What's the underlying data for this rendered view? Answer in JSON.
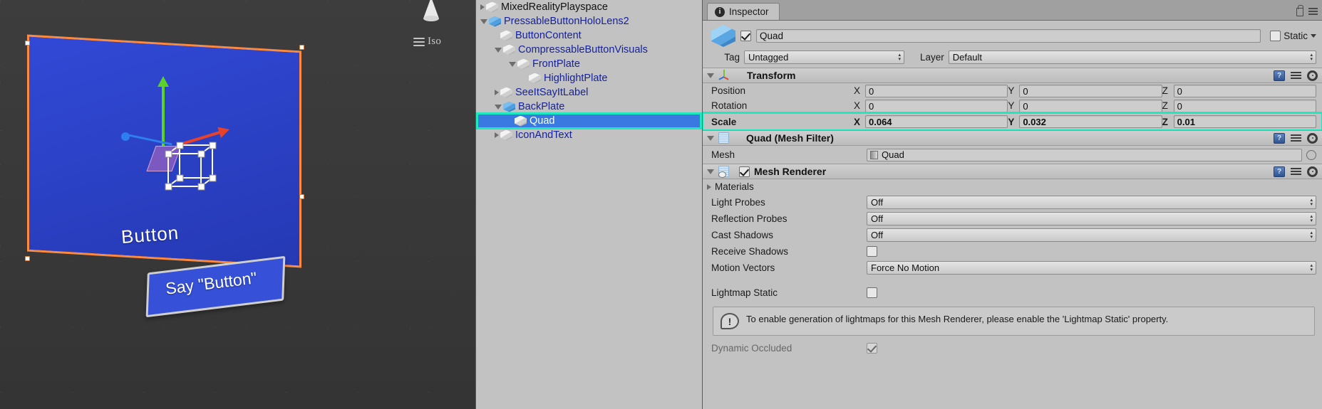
{
  "scene": {
    "view_label": "Iso",
    "button_text": "Button",
    "say_text": "Say \"Button\"",
    "gizmo_icon": "view-cube-gizmo",
    "colors": {
      "quad_fill": "#2b43c9",
      "quad_outline": "#ff8a3c",
      "x_axis": "#e8432a",
      "y_axis": "#5bd12a",
      "z_axis": "#2d7ff0"
    }
  },
  "hierarchy": {
    "items": [
      {
        "label": "MixedRealityPlayspace",
        "indent": 0,
        "toggle": "collapsed",
        "icon": "cube-icon",
        "color": "#111111",
        "selected": false
      },
      {
        "label": "PressableButtonHoloLens2",
        "indent": 0,
        "toggle": "expanded",
        "icon": "prefab-cube-icon",
        "color": "#16229a",
        "selected": false
      },
      {
        "label": "ButtonContent",
        "indent": 1,
        "toggle": "none",
        "icon": "cube-icon",
        "color": "#16229a",
        "selected": false
      },
      {
        "label": "CompressableButtonVisuals",
        "indent": 1,
        "toggle": "expanded",
        "icon": "cube-icon",
        "color": "#16229a",
        "selected": false
      },
      {
        "label": "FrontPlate",
        "indent": 2,
        "toggle": "expanded",
        "icon": "cube-icon",
        "color": "#16229a",
        "selected": false
      },
      {
        "label": "HighlightPlate",
        "indent": 3,
        "toggle": "none",
        "icon": "cube-icon",
        "color": "#16229a",
        "selected": false
      },
      {
        "label": "SeeItSayItLabel",
        "indent": 1,
        "toggle": "collapsed",
        "icon": "cube-icon",
        "color": "#16229a",
        "selected": false
      },
      {
        "label": "BackPlate",
        "indent": 1,
        "toggle": "expanded",
        "icon": "prefab-cube-icon",
        "color": "#16229a",
        "selected": false
      },
      {
        "label": "Quad",
        "indent": 2,
        "toggle": "none",
        "icon": "cube-icon",
        "color": "#ffffff",
        "selected": true
      },
      {
        "label": "IconAndText",
        "indent": 1,
        "toggle": "collapsed",
        "icon": "cube-icon",
        "color": "#16229a",
        "selected": false
      }
    ],
    "selection_outline_color": "#1de8c0"
  },
  "inspector": {
    "tab_label": "Inspector",
    "tab_icon": "info-icon",
    "lock_icon": "lock-icon",
    "menu_icon": "hamburger-menu-icon",
    "object": {
      "name": "Quad",
      "enabled": true,
      "static_label": "Static",
      "static_checked": false,
      "tag_label": "Tag",
      "tag_value": "Untagged",
      "layer_label": "Layer",
      "layer_value": "Default"
    },
    "transform": {
      "title": "Transform",
      "icon": "transform-axis-icon",
      "rows": [
        {
          "label": "Position",
          "x": "0",
          "y": "0",
          "z": "0",
          "highlight": false
        },
        {
          "label": "Rotation",
          "x": "0",
          "y": "0",
          "z": "0",
          "highlight": false
        },
        {
          "label": "Scale",
          "x": "0.064",
          "y": "0.032",
          "z": "0.01",
          "highlight": true
        }
      ],
      "axis_labels": {
        "x": "X",
        "y": "Y",
        "z": "Z"
      }
    },
    "mesh_filter": {
      "title": "Quad (Mesh Filter)",
      "icon": "mesh-filter-icon",
      "mesh_label": "Mesh",
      "mesh_value": "Quad"
    },
    "mesh_renderer": {
      "title": "Mesh Renderer",
      "icon": "mesh-renderer-icon",
      "enabled": true,
      "materials_label": "Materials",
      "properties": [
        {
          "label": "Light Probes",
          "type": "popup",
          "value": "Off"
        },
        {
          "label": "Reflection Probes",
          "type": "popup",
          "value": "Off"
        },
        {
          "label": "Cast Shadows",
          "type": "popup",
          "value": "Off"
        },
        {
          "label": "Receive Shadows",
          "type": "checkbox",
          "checked": false
        },
        {
          "label": "Motion Vectors",
          "type": "popup",
          "value": "Force No Motion"
        },
        {
          "label": "Lightmap Static",
          "type": "checkbox",
          "checked": false
        }
      ],
      "help_text": "To enable generation of lightmaps for this Mesh Renderer, please enable the 'Lightmap Static' property.",
      "help_icon": "warning-icon",
      "cut_off_row_label": "Dynamic Occluded"
    },
    "component_tool_icons": [
      "help-book-icon",
      "preset-icon",
      "gear-icon"
    ]
  }
}
